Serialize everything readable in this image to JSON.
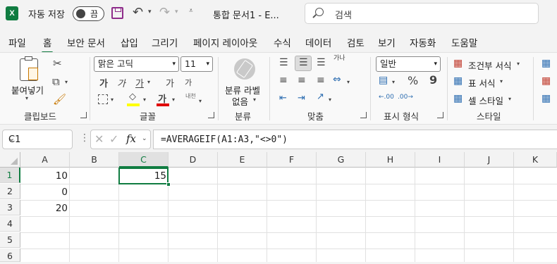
{
  "titlebar": {
    "app_logo": "X",
    "autosave_label": "자동 저장",
    "autosave_state": "끔",
    "document_title": "통합 문서1 - E...",
    "search_placeholder": "검색"
  },
  "tabs": [
    "파일",
    "홈",
    "보안 문서",
    "삽입",
    "그리기",
    "페이지 레이아웃",
    "수식",
    "데이터",
    "검토",
    "보기",
    "자동화",
    "도움말"
  ],
  "active_tab": "홈",
  "ribbon": {
    "clipboard": {
      "paste_label": "붙여넣기",
      "group_label": "클립보드"
    },
    "font": {
      "font_name": "맑은 고딕",
      "font_size": "11",
      "group_label": "글꼴",
      "bold": "가",
      "italic": "가",
      "underline": "가",
      "grow": "가",
      "shrink": "가",
      "font_color": "가",
      "phonetic": "내천"
    },
    "sensitivity": {
      "label_line1": "분류 라벨",
      "label_line2": "없음",
      "group_label": "분류"
    },
    "alignment": {
      "group_label": "맞춤",
      "wrap": "가나"
    },
    "number": {
      "format": "일반",
      "percent": "%",
      "comma": "9",
      "group_label": "표시 형식"
    },
    "styles": {
      "conditional": "조건부 서식",
      "table": "표 서식",
      "cell": "셀 스타일",
      "group_label": "스타일"
    }
  },
  "formula_bar": {
    "name_box": "C1",
    "fx": "fx",
    "formula": "=AVERAGEIF(A1:A3,\"<>0\")"
  },
  "grid": {
    "columns": [
      "A",
      "B",
      "C",
      "D",
      "E",
      "F",
      "G",
      "H",
      "I",
      "J",
      "K"
    ],
    "rows": [
      "1",
      "2",
      "3",
      "4",
      "5",
      "6"
    ],
    "cells": {
      "A1": "10",
      "A2": "0",
      "A3": "20",
      "C1": "15"
    },
    "active_cell": "C1"
  },
  "colors": {
    "accent": "#107c41",
    "save_icon": "#8e2c8a"
  }
}
